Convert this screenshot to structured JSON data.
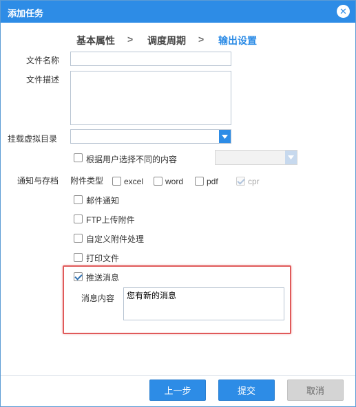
{
  "dialog": {
    "title": "添加任务",
    "close_icon": "close-icon"
  },
  "steps": {
    "step1": "基本属性",
    "sep1": ">",
    "step2": "调度周期",
    "sep2": ">",
    "step3": "输出设置"
  },
  "form": {
    "file_name_label": "文件名称",
    "file_name_value": "",
    "file_desc_label": "文件描述",
    "file_desc_value": "",
    "mount_dir_label": "挂载虚拟目录",
    "mount_dir_value": "",
    "by_user_choice_label": "根据用户选择不同的内容",
    "notify_label": "通知与存档",
    "attachment_type_label": "附件类型",
    "attach_excel": "excel",
    "attach_word": "word",
    "attach_pdf": "pdf",
    "attach_cpr": "cpr",
    "mail_notify": "邮件通知",
    "ftp_upload": "FTP上传附件",
    "custom_attach": "自定义附件处理",
    "print_file": "打印文件",
    "push_message": "推送消息",
    "message_content_label": "消息内容",
    "message_content_value": "您有新的消息"
  },
  "footer": {
    "prev_label": "上一步",
    "submit_label": "提交",
    "cancel_label": "取消"
  },
  "colors": {
    "accent": "#2d8ce6",
    "highlight_border": "#e05a5a"
  }
}
